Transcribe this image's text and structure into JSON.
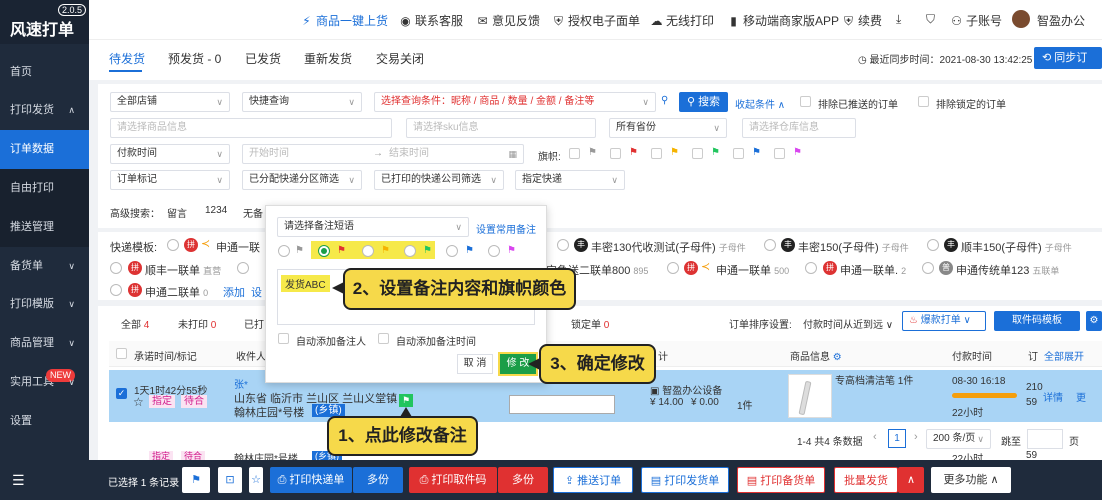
{
  "sidebar": {
    "logo": "风速打单",
    "version": "2.0.5",
    "items": [
      {
        "label": "首页"
      },
      {
        "label": "打印发货",
        "chevron": "∧"
      },
      {
        "label": "订单数据"
      },
      {
        "label": "自由打印"
      },
      {
        "label": "推送管理"
      },
      {
        "label": "备货单",
        "chevron": "∨"
      },
      {
        "label": "打印模版",
        "chevron": "∨"
      },
      {
        "label": "商品管理",
        "chevron": "∨"
      },
      {
        "label": "实用工具",
        "chevron": "∨",
        "badge": "NEW"
      },
      {
        "label": "设置"
      }
    ]
  },
  "header": {
    "links": [
      {
        "icon": "lightning-icon",
        "label": "商品一键上货"
      },
      {
        "icon": "service-icon",
        "label": "联系客服"
      },
      {
        "icon": "mail-icon",
        "label": "意见反馈"
      },
      {
        "icon": "shield-icon",
        "label": "授权电子面单"
      },
      {
        "icon": "wifi-icon",
        "label": "无线打印"
      },
      {
        "icon": "phone-icon",
        "label": "移动端商家版APP"
      },
      {
        "icon": "renew-icon",
        "label": "续费"
      },
      {
        "icon": "download-icon",
        "label": ""
      },
      {
        "icon": "shirt-icon",
        "label": ""
      },
      {
        "icon": "users-icon",
        "label": "子账号"
      },
      {
        "icon": "avatar",
        "label": "智盈办公"
      }
    ]
  },
  "tabs": [
    "待发货",
    "预发货 - 0",
    "已发货",
    "重新发货",
    "交易关闭"
  ],
  "sync": {
    "text": "最近同步时间：2021-08-30 13:42:25",
    "button": "同步订"
  },
  "filters": {
    "shops": "全部店铺",
    "quick": "快捷查询",
    "condition": "选择查询条件：昵称 / 商品 / 数量 / 金额 / 备注等",
    "search": "搜索",
    "collapse": "收起条件",
    "exclude_pushed": "排除已推送的订单",
    "exclude_locked": "排除锁定的订单",
    "goods_ph": "请选择商品信息",
    "sku_ph": "请选择sku信息",
    "province": "所有省份",
    "warehouse_ph": "请选择仓库信息",
    "pay_time": "付款时间",
    "start_ph": "开始时间",
    "end_ph": "结束时间",
    "flag_label": "旗帜:",
    "order_mark": "订单标记",
    "assigned": "已分配快递分区筛选",
    "printed": "已打印的快递公司筛选",
    "express": "指定快递",
    "advanced": "高级搜索：",
    "adv1": "留言",
    "adv2": "1234",
    "adv3": "无备"
  },
  "templates": {
    "label": "快递模板:",
    "items": [
      {
        "name": "申通一联",
        "sub": ""
      },
      {
        "name": "丰密130代收测试(子母件)",
        "sub": "子母件"
      },
      {
        "name": "丰密150(子母件)",
        "sub": "子母件"
      },
      {
        "name": "顺丰150(子母件)",
        "sub": "子母件"
      },
      {
        "name": "顺丰一联单",
        "sub": "直营"
      },
      {
        "name": "宝急送二联单800",
        "sub": "895"
      },
      {
        "name": "申通一联单",
        "sub": "500"
      },
      {
        "name": "申通一联单.",
        "sub": "2"
      },
      {
        "name": "申通传统单123",
        "sub": "五联单"
      },
      {
        "name": "申通二联单",
        "sub": "0"
      }
    ],
    "add": "添加",
    "settings": "设"
  },
  "orders": {
    "filters": [
      {
        "label": "全部",
        "count": "4"
      },
      {
        "label": "未打印",
        "count": "0"
      },
      {
        "label": "已打",
        "count": ""
      }
    ],
    "locked": "锁定单",
    "locked_count": "0",
    "sort_label": "订单排序设置:",
    "sort_value": "付款时间从近到远",
    "hot_print": "爆款打单",
    "pick_template": "取件码模板",
    "headers": [
      "承诺时间/标记",
      "收件人",
      "计",
      "商品信息",
      "付款时间",
      "订",
      "全部展开"
    ],
    "row": {
      "countdown": "1天1时42分55秒",
      "tag1": "指定",
      "tag2": "待合",
      "receiver": "张*",
      "address1": "山东省 临沂市 兰山区 兰山义堂镇",
      "address2": "翰林庄园*号楼",
      "town": "(乡镇)",
      "shop": "智盈办公设备",
      "price1": "¥ 14.00",
      "price2": "¥ 0.00",
      "qty": "1件",
      "product": "专高档清洁笔 1件",
      "pay_date": "08-30 16:18",
      "remaining": "22小时",
      "order_no1": "210",
      "order_no2": "59",
      "detail": "详情",
      "more": "更"
    },
    "row2": {
      "tag1": "指定",
      "tag2": "待合",
      "address": "翰林庄园*号楼",
      "town": "(乡镇)",
      "remaining": "22小时",
      "order_no": "59"
    },
    "pager": {
      "total": "1-4 共4 条数据",
      "page": "1",
      "size": "200 条/页",
      "jump": "跳至",
      "page_unit": "页"
    }
  },
  "bottom": {
    "selected": "已选择 1 条记录",
    "print_express": "打印快递单",
    "copies": "多份",
    "print_pick": "打印取件码",
    "copies2": "多份",
    "push": "推送订单",
    "print_ship": "打印发货单",
    "print_stock": "打印备货单",
    "batch_ship": "批量发货",
    "more": "更多功能"
  },
  "modal": {
    "select_ph": "请选择备注短语",
    "common": "设置常用备注",
    "note": "发货ABC",
    "auto_person": "自动添加备注人",
    "auto_time": "自动添加备注时间",
    "cancel": "取 消",
    "confirm": "修 改"
  },
  "callouts": {
    "step1": "1、点此修改备注",
    "step2": "2、设置备注内容和旗帜颜色",
    "step3": "3、确定修改"
  },
  "colors": {
    "primary": "#1b6fd8",
    "sidebar": "#1f2b3c",
    "callout": "#f6d94a",
    "danger": "#e03131",
    "confirm": "#1b9e48"
  }
}
